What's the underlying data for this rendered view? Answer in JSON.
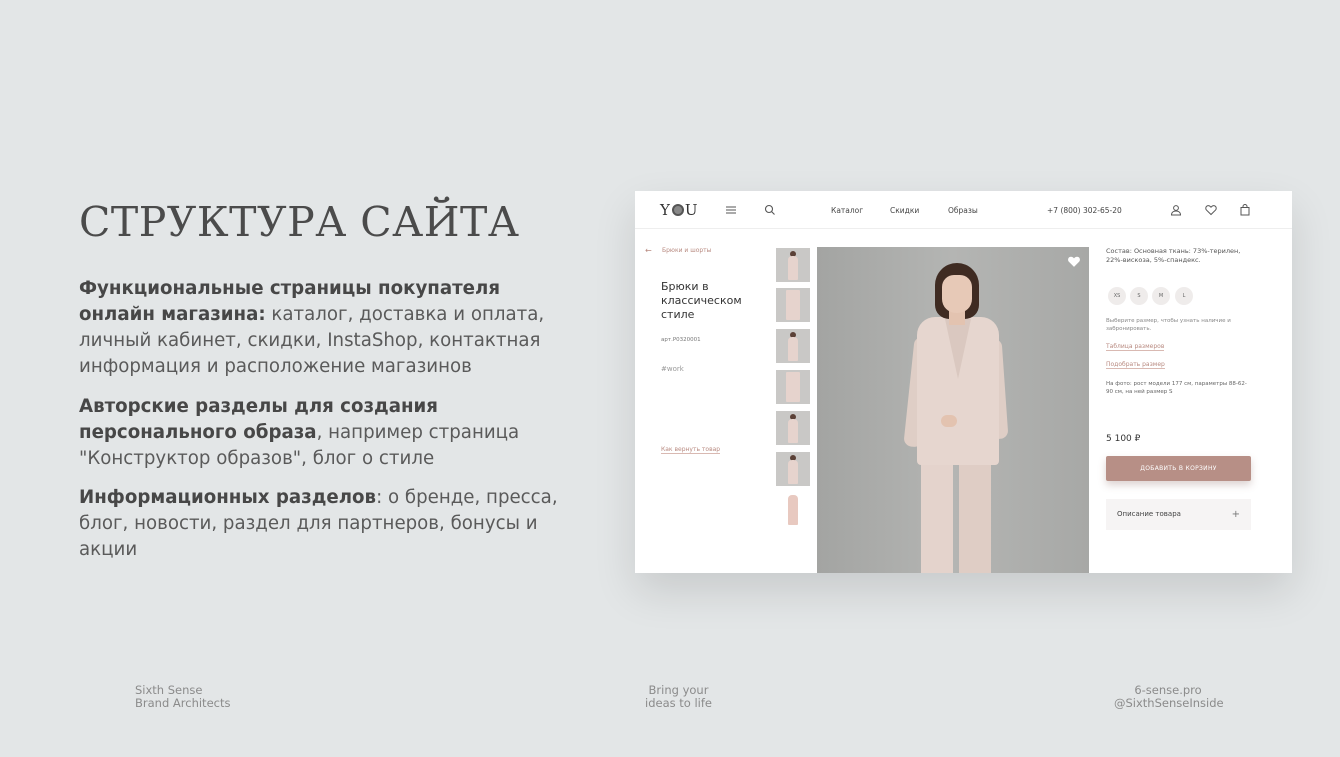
{
  "slide": {
    "title": "СТРУКТУРА САЙТА",
    "paragraphs": [
      {
        "bold": "Функциональные страницы покупателя онлайн магазина:",
        "text": " каталог, доставка и оплата, личный кабинет, скидки, InstaShop, контактная информация и расположение магазинов"
      },
      {
        "bold": "Авторские разделы для создания персонального образа",
        "text": ", например страница \"Конструктор образов\", блог о стиле"
      },
      {
        "bold": "Информационных разделов",
        "text": ": о бренде, пресса, блог, новости, раздел для партнеров, бонусы и акции"
      }
    ]
  },
  "footer": {
    "left_line1": "Sixth Sense",
    "left_line2": "Brand Architects",
    "center_line1": "Bring your",
    "center_line2": "ideas to life",
    "right_line1": "6-sense.pro",
    "right_line2": "@SixthSenseInside"
  },
  "mockup": {
    "logo_left": "Y",
    "logo_right": "U",
    "nav": [
      "Каталог",
      "Скидки",
      "Образы"
    ],
    "phone": "+7 (800) 302-65-20",
    "icons": [
      "menu-icon",
      "search-icon",
      "user-icon",
      "heart-icon",
      "bag-icon"
    ],
    "breadcrumb": "Брюки и шорты",
    "product_title": "Брюки в классическом стиле",
    "article": "арт.P0320001",
    "tag": "#work",
    "return_link": "Как вернуть товар",
    "composition": "Состав: Основная ткань: 73%-терилен, 22%-вискоза, 5%-спандекс.",
    "sizes": [
      "XS",
      "S",
      "M",
      "L"
    ],
    "size_hint": "Выберите размер, чтобы узнать наличие и забронировать.",
    "size_table_link": "Таблица размеров",
    "pick_size_link": "Подобрать размер",
    "photo_note": "На фото: рост модели 177 см, параметры 88-62-90 см, на ней размер S",
    "price": "5 100 ₽",
    "add_to_cart": "ДОБАВИТЬ В КОРЗИНУ",
    "description_label": "Описание товара",
    "description_toggle": "+",
    "accent_color": "#b78f86"
  }
}
